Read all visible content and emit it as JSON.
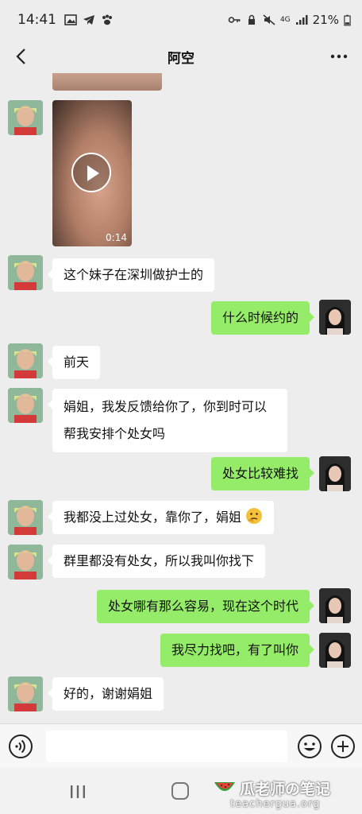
{
  "status_bar": {
    "time": "14:41",
    "battery": "21%",
    "network": "4G"
  },
  "header": {
    "title": "阿空"
  },
  "video": {
    "duration": "0:14"
  },
  "messages": [
    {
      "side": "left",
      "text": "这个妹子在深圳做护士的"
    },
    {
      "side": "right",
      "text": "什么时候约的"
    },
    {
      "side": "left",
      "text": "前天"
    },
    {
      "side": "left",
      "text": "娟姐，我发反馈给你了，你到时可以帮我安排个处女吗"
    },
    {
      "side": "right",
      "text": "处女比较难找"
    },
    {
      "side": "left",
      "text": "我都没上过处女，靠你了，娟姐"
    },
    {
      "side": "left",
      "text": "群里都没有处女，所以我叫你找下"
    },
    {
      "side": "right",
      "text": "处女哪有那么容易，现在这个时代"
    },
    {
      "side": "right",
      "text": "我尽力找吧，有了叫你"
    },
    {
      "side": "left",
      "text": "好的，谢谢娟姐"
    }
  ],
  "input": {
    "value": "",
    "placeholder": ""
  },
  "watermark": {
    "title": "瓜老师の笔记",
    "url": "teachergua.org"
  },
  "colors": {
    "background": "#ededed",
    "sent_bubble": "#95ec69",
    "received_bubble": "#ffffff"
  }
}
